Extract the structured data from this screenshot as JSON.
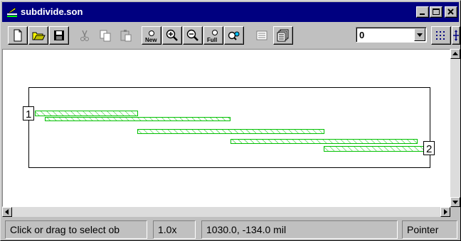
{
  "window": {
    "title": "subdivide.son"
  },
  "toolbar": {
    "buttons": [
      "new-file",
      "open-folder",
      "save",
      "cut",
      "copy",
      "paste",
      "new-view",
      "zoom-in",
      "zoom-out",
      "zoom-full",
      "zoom-options",
      "layers",
      "layer-stack"
    ],
    "new_label": "New",
    "full_label": "Full",
    "level_value": "0"
  },
  "canvas": {
    "port_labels": [
      "1",
      "2"
    ],
    "stroke_color": "#00c000"
  },
  "status": {
    "message": "Click or drag to select ob",
    "zoom": "1.0x",
    "coords": "1030.0, -134.0 mil",
    "mode": "Pointer"
  }
}
